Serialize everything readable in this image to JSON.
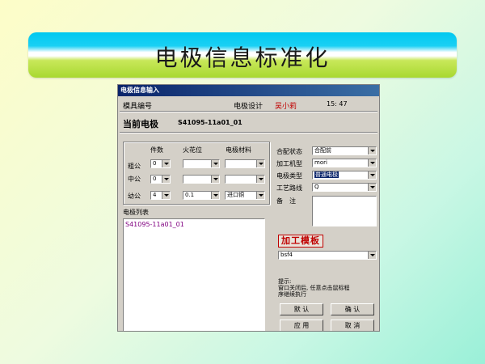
{
  "slide": {
    "title": "电极信息标准化"
  },
  "dialog": {
    "title": "电极信息输入",
    "mold_label": "模具编号",
    "designer_label": "电极设计",
    "designer_name": "吴小莉",
    "time": "15: 47",
    "current_label": "当前电极",
    "current_value": "S41095-11a01_01",
    "columns": {
      "count": "件数",
      "spark": "火花位",
      "material": "电极材料"
    },
    "rows": [
      {
        "label": "粗公",
        "count": "0",
        "spark": "",
        "material": ""
      },
      {
        "label": "中公",
        "count": "0",
        "spark": "",
        "material": ""
      },
      {
        "label": "幼公",
        "count": "4",
        "spark": "0.1",
        "material": "进口铜"
      }
    ],
    "fields": {
      "assembly_label": "合配状态",
      "assembly_value": "合配前",
      "machine_label": "加工机型",
      "machine_value": "mori",
      "type_label": "电极类型",
      "type_value": "普通电极",
      "route_label": "工艺路线",
      "route_value": "Q",
      "note_label": "备　注"
    },
    "list_label": "电极列表",
    "list_items": [
      "S41095-11a01_01"
    ],
    "template_label": "加工模板",
    "template_value": "bsf4",
    "hint_title": "提示:",
    "hint_line1": "窗口关闭后, 任意点击鼠标程",
    "hint_line2": "序继续执行",
    "buttons": {
      "default": "默 认",
      "ok": "确 认",
      "apply": "应 用",
      "cancel": "取 消"
    },
    "colors": {
      "title_bar": "#0a246a",
      "designer": "#c00000",
      "list_text": "#800080",
      "template": "#c00000"
    }
  }
}
